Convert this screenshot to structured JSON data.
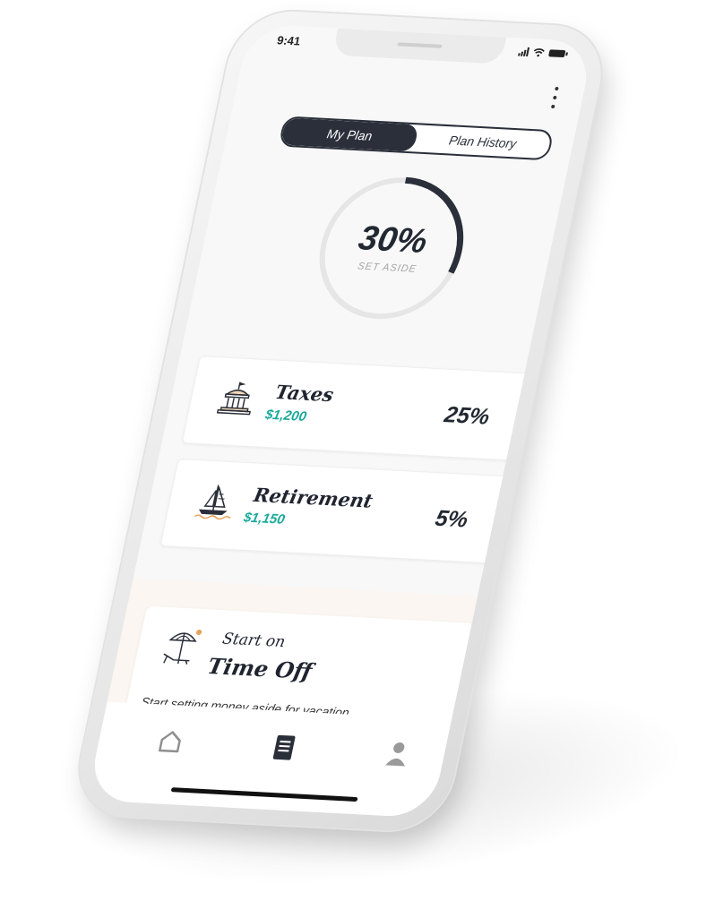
{
  "status_bar": {
    "time": "9:41"
  },
  "segmented_control": {
    "options": [
      {
        "label": "My Plan",
        "selected": true
      },
      {
        "label": "Plan History",
        "selected": false
      }
    ]
  },
  "progress_ring": {
    "percent_label": "30%",
    "caption": "SET ASIDE",
    "fill_fraction": 0.3,
    "track_color": "#e6e6e6",
    "fill_color": "#2a2f3a"
  },
  "allocations": [
    {
      "title": "Taxes",
      "amount": "$1,200",
      "percent": "25%",
      "icon": "government-building-icon"
    },
    {
      "title": "Retirement",
      "amount": "$1,150",
      "percent": "5%",
      "icon": "sailboat-icon"
    }
  ],
  "promo": {
    "eyebrow": "Start on",
    "title": "Time Off",
    "description": "Start setting money aside for vacation",
    "icon": "beach-umbrella-chair-icon"
  },
  "tab_bar": {
    "items": [
      {
        "name": "home",
        "icon": "home-icon",
        "active": false
      },
      {
        "name": "plan",
        "icon": "document-icon",
        "active": true
      },
      {
        "name": "profile",
        "icon": "person-icon",
        "active": false
      }
    ]
  },
  "colors": {
    "accent_dark": "#2a2f3a",
    "accent_teal": "#19a99a",
    "promo_background": "#fbf6f1"
  }
}
